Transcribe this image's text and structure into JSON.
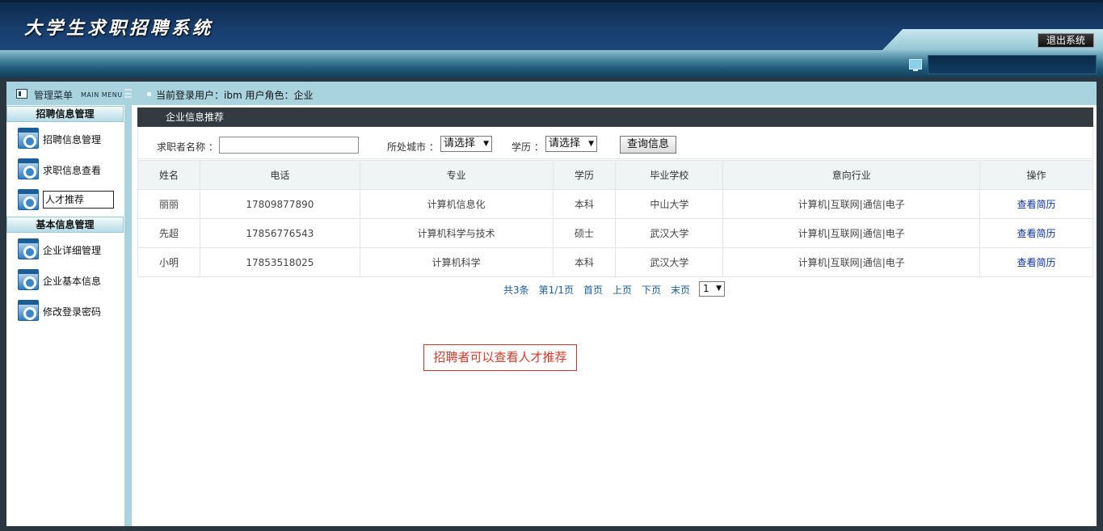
{
  "header": {
    "title": "大学生求职招聘系统",
    "logout_label": "退出系统"
  },
  "sidebar": {
    "menu_title": "管理菜单",
    "menu_sub": "MAIN MENU",
    "sections": [
      {
        "title": "招聘信息管理",
        "items": [
          {
            "label": "招聘信息管理"
          },
          {
            "label": "求职信息查看"
          },
          {
            "label": "人才推荐"
          }
        ]
      },
      {
        "title": "基本信息管理",
        "items": [
          {
            "label": "企业详细管理"
          },
          {
            "label": "企业基本信息"
          },
          {
            "label": "修改登录密码"
          }
        ]
      }
    ],
    "active_item": "人才推荐"
  },
  "main": {
    "user_info": "当前登录用户：ibm  用户角色：企业",
    "panel_title": "企业信息推荐",
    "search": {
      "name_label": "求职者名称 ：",
      "name_value": "",
      "city_label": "所处城市 ：",
      "city_value": "请选择",
      "edu_label": "学历 ：",
      "edu_value": "请选择",
      "query_label": "查询信息"
    },
    "table": {
      "columns": [
        "姓名",
        "电话",
        "专业",
        "学历",
        "毕业学校",
        "意向行业",
        "操作"
      ],
      "rows": [
        {
          "name": "丽丽",
          "phone": "17809877890",
          "major": "计算机信息化",
          "edu": "本科",
          "school": "中山大学",
          "industry": "计算机|互联网|通信|电子",
          "action": "查看简历"
        },
        {
          "name": "先超",
          "phone": "17856776543",
          "major": "计算机科学与技术",
          "edu": "硕士",
          "school": "武汉大学",
          "industry": "计算机|互联网|通信|电子",
          "action": "查看简历"
        },
        {
          "name": "小明",
          "phone": "17853518025",
          "major": "计算机科学",
          "edu": "本科",
          "school": "武汉大学",
          "industry": "计算机|互联网|通信|电子",
          "action": "查看简历"
        }
      ]
    },
    "pager": {
      "total": "共3条",
      "page": "第1/1页",
      "first": "首页",
      "prev": "上页",
      "next": "下页",
      "last": "末页",
      "page_select": "1"
    },
    "note": "招聘者可以查看人才推荐"
  }
}
